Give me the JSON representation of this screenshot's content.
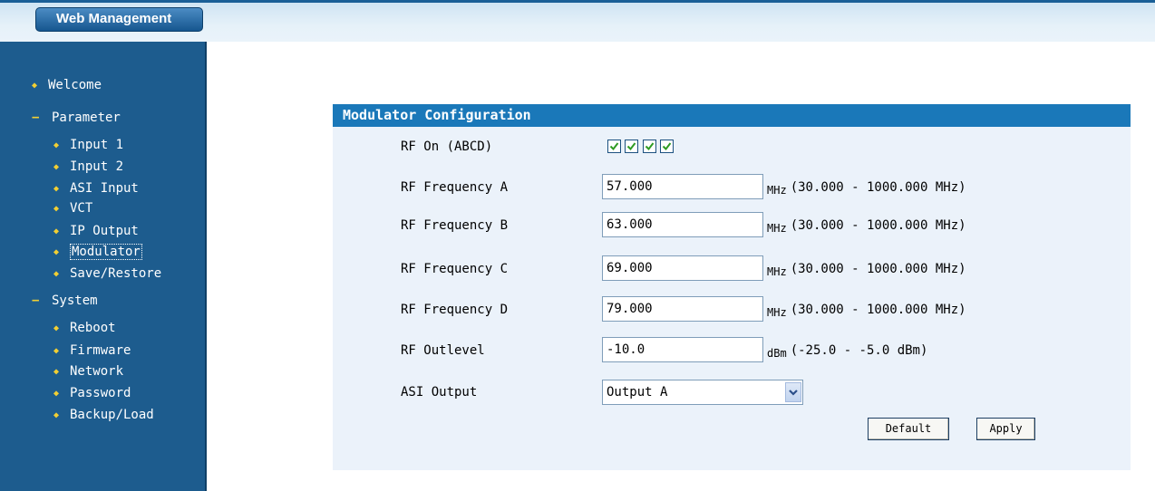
{
  "app": {
    "brand": "Web Management"
  },
  "sidebar": {
    "welcome": "Welcome",
    "parameter": {
      "label": "Parameter",
      "items": [
        "Input 1",
        "Input 2",
        "ASI Input",
        "VCT",
        "IP Output",
        "Modulator",
        "Save/Restore"
      ]
    },
    "system": {
      "label": "System",
      "items": [
        "Reboot",
        "Firmware",
        "Network",
        "Password",
        "Backup/Load"
      ]
    }
  },
  "panel": {
    "title": "Modulator Configuration",
    "rf_on": {
      "label": "RF On (ABCD)",
      "checks": [
        true,
        true,
        true,
        true
      ]
    },
    "freq_a": {
      "label": "RF Frequency A",
      "value": "57.000",
      "unit": "MHz",
      "range": "(30.000 - 1000.000 MHz)"
    },
    "freq_b": {
      "label": "RF Frequency B",
      "value": "63.000",
      "unit": "MHz",
      "range": "(30.000 - 1000.000 MHz)"
    },
    "freq_c": {
      "label": "RF Frequency C",
      "value": "69.000",
      "unit": "MHz",
      "range": "(30.000 - 1000.000 MHz)"
    },
    "freq_d": {
      "label": "RF Frequency D",
      "value": "79.000",
      "unit": "MHz",
      "range": "(30.000 - 1000.000 MHz)"
    },
    "outlevel": {
      "label": "RF Outlevel",
      "value": "-10.0",
      "unit": "dBm",
      "range": "(-25.0 - -5.0 dBm)"
    },
    "asi_output": {
      "label": "ASI Output",
      "selected": "Output A"
    },
    "buttons": {
      "default": "Default",
      "apply": "Apply"
    }
  },
  "colors": {
    "sidebar_bg": "#1d5c8e",
    "accent_bullet": "#f2cf33",
    "panel_title_bg": "#1a78b9",
    "panel_bg": "#ebf2fa",
    "check_color": "#2f9b22"
  },
  "icons": {
    "bullet": "bullet-dot-icon",
    "section": "minus-icon",
    "dropdown": "chevron-down-icon",
    "check": "checkmark-icon"
  }
}
